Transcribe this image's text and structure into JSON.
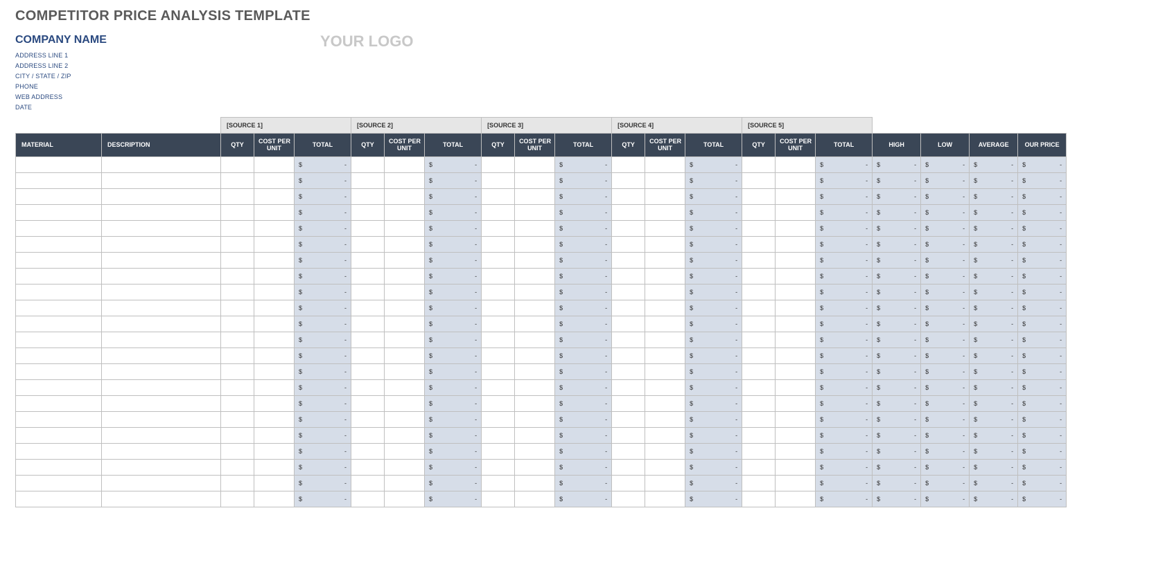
{
  "title": "COMPETITOR PRICE ANALYSIS TEMPLATE",
  "company": {
    "name": "COMPANY NAME",
    "addr1": "ADDRESS LINE 1",
    "addr2": "ADDRESS LINE 2",
    "csz": "CITY / STATE / ZIP",
    "phone": "PHONE",
    "web": "WEB ADDRESS",
    "date": "DATE"
  },
  "logo": "YOUR LOGO",
  "sources": [
    "[SOURCE 1]",
    "[SOURCE 2]",
    "[SOURCE 3]",
    "[SOURCE 4]",
    "[SOURCE 5]"
  ],
  "cols": {
    "material": "MATERIAL",
    "description": "DESCRIPTION",
    "qty": "QTY",
    "cpu": "COST PER UNIT",
    "total": "TOTAL",
    "high": "HIGH",
    "low": "LOW",
    "avg": "AVERAGE",
    "our": "OUR PRICE"
  },
  "money": {
    "currency": "$",
    "dash": "-"
  },
  "row_count": 22
}
